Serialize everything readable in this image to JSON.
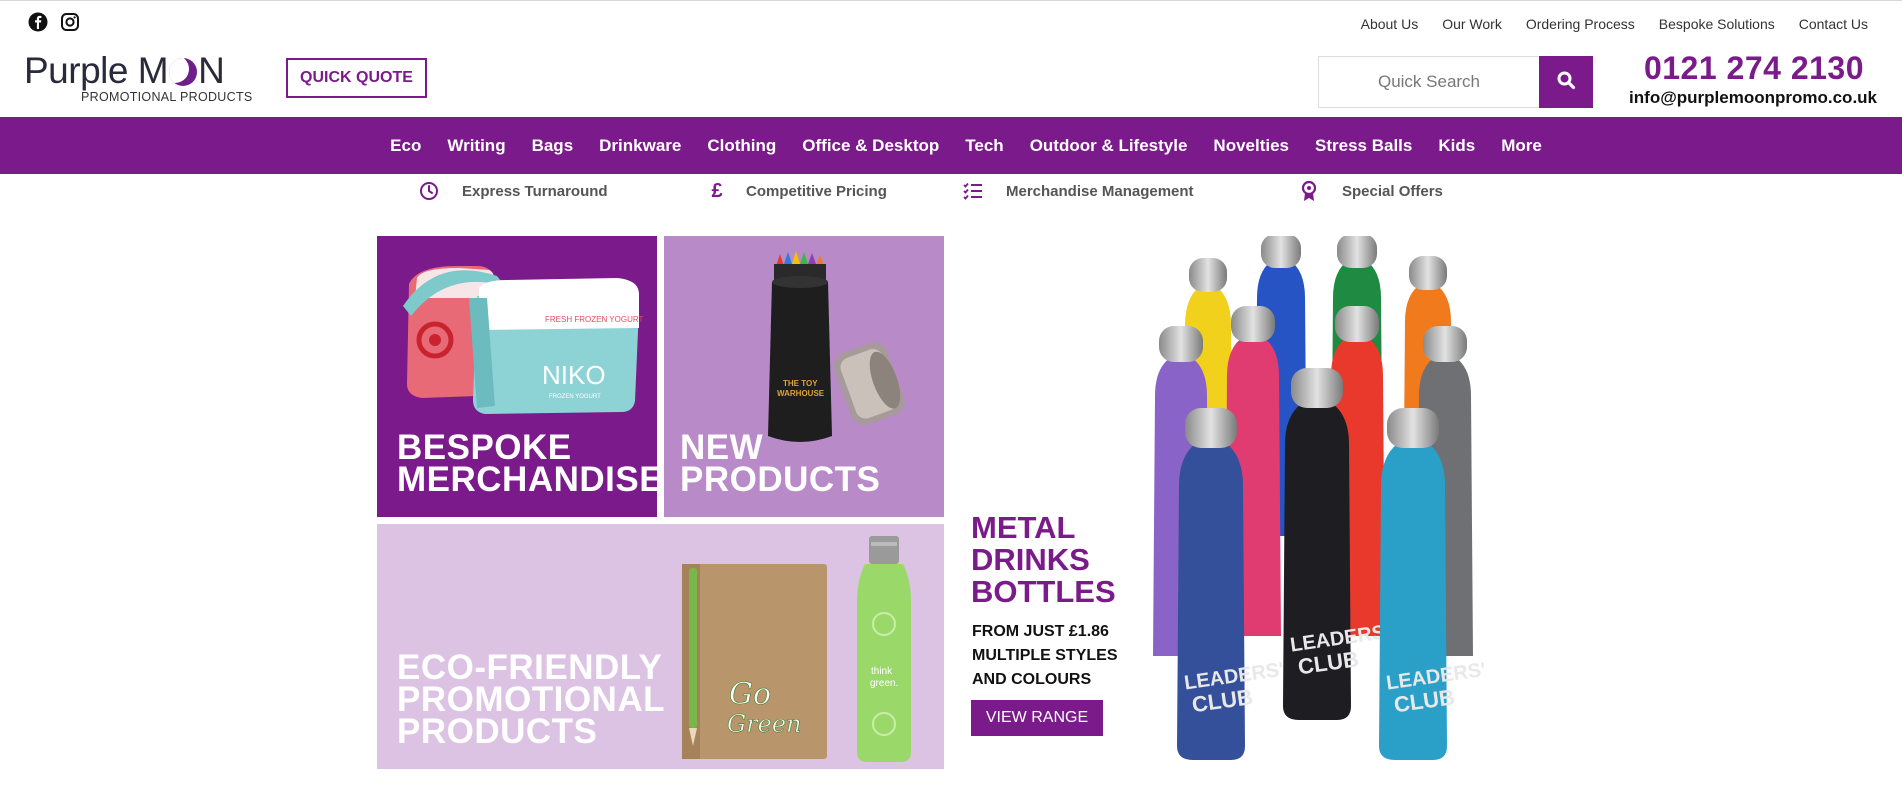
{
  "social": [
    {
      "name": "facebook-icon"
    },
    {
      "name": "instagram-icon"
    }
  ],
  "top_links": [
    "About Us",
    "Our Work",
    "Ordering Process",
    "Bespoke Solutions",
    "Contact Us"
  ],
  "logo": {
    "word1": "Purple M",
    "word2": "N",
    "sub": "PROMOTIONAL PRODUCTS"
  },
  "quick_quote": "QUICK QUOTE",
  "search": {
    "placeholder": "Quick Search",
    "icon": "search-icon"
  },
  "contact": {
    "phone": "0121 274 2130",
    "email": "info@purplemoonpromo.co.uk"
  },
  "nav": [
    "Eco",
    "Writing",
    "Bags",
    "Drinkware",
    "Clothing",
    "Office & Desktop",
    "Tech",
    "Outdoor & Lifestyle",
    "Novelties",
    "Stress Balls",
    "Kids",
    "More"
  ],
  "usps": [
    {
      "icon": "clock-icon",
      "label": "Express Turnaround"
    },
    {
      "icon": "pound-icon",
      "label": "Competitive Pricing"
    },
    {
      "icon": "checklist-icon",
      "label": "Merchandise Management"
    },
    {
      "icon": "award-icon",
      "label": "Special Offers"
    }
  ],
  "tiles": {
    "bespoke": {
      "line1": "BESPOKE",
      "line2": "MERCHANDISE"
    },
    "new": {
      "line1": "NEW",
      "line2": "PRODUCTS"
    },
    "eco": {
      "line1": "ECO-FRIENDLY",
      "line2": "PROMOTIONAL",
      "line3": "PRODUCTS"
    }
  },
  "feature": {
    "line1": "METAL",
    "line2": "DRINKS",
    "line3": "BOTTLES",
    "sub1": "FROM JUST £1.86",
    "sub2": "MULTIPLE STYLES",
    "sub3": "AND COLOURS",
    "button": "VIEW RANGE"
  },
  "colors": {
    "brand": "#7b1a8a",
    "tile_mid": "#b98ac8",
    "tile_light": "#dcc3e3"
  }
}
